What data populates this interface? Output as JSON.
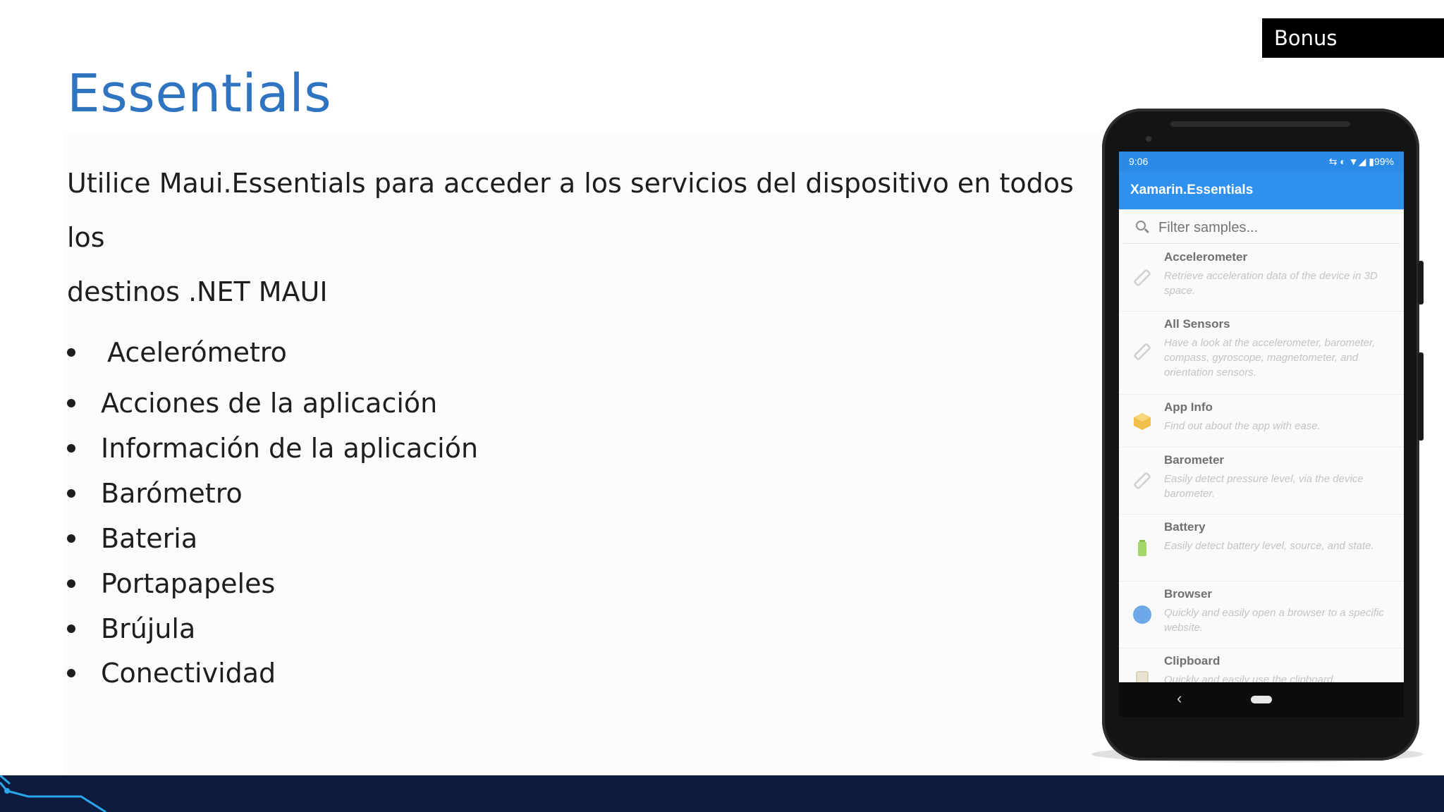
{
  "slide": {
    "badge": "Bonus",
    "title": "Essentials",
    "intro_line1": "Utilice Maui.Essentials para acceder a los servicios del dispositivo en todos los",
    "intro_line2": "destinos .NET MAUI",
    "bullets": [
      "Acelerómetro",
      "Acciones de la aplicación",
      "Información de la aplicación",
      "Barómetro",
      "Bateria",
      "Portapapeles",
      "Brújula",
      "Conectividad"
    ]
  },
  "phone": {
    "status_time": "9:06",
    "status_icons": "⇆ ◐ ▼◢ ▮99%",
    "app_title": "Xamarin.Essentials",
    "search_placeholder": "Filter samples...",
    "items": [
      {
        "name": "Accelerometer",
        "desc": "Retrieve acceleration data of the device in 3D space.",
        "icon": "pencil-icon"
      },
      {
        "name": "All Sensors",
        "desc": "Have a look at the accelerometer, barometer, compass, gyroscope, magnetometer, and orientation sensors.",
        "icon": "pencil-icon"
      },
      {
        "name": "App Info",
        "desc": "Find out about the app with ease.",
        "icon": "box-icon"
      },
      {
        "name": "Barometer",
        "desc": "Easily detect pressure level, via the device barometer.",
        "icon": "pencil-icon"
      },
      {
        "name": "Battery",
        "desc": "Easily detect battery level, source, and state.",
        "icon": "battery-icon"
      },
      {
        "name": "Browser",
        "desc": "Quickly and easily open a browser to a specific website.",
        "icon": "globe-icon"
      },
      {
        "name": "Clipboard",
        "desc": "Quickly and easily use the clipboard.",
        "icon": "clipboard-icon"
      }
    ],
    "nav_back": "‹"
  },
  "colors": {
    "title_blue": "#2f74c0",
    "appbar_blue": "#2f90ee",
    "footer_navy": "#0d1b3e"
  }
}
